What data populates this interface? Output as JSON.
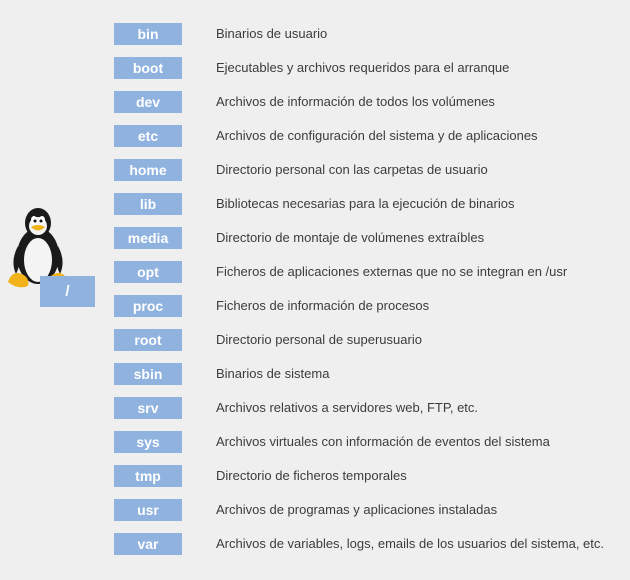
{
  "root": {
    "label": "/"
  },
  "directories": [
    {
      "name": "bin",
      "description": "Binarios de usuario"
    },
    {
      "name": "boot",
      "description": "Ejecutables y archivos requeridos para el arranque"
    },
    {
      "name": "dev",
      "description": "Archivos de información de todos los volúmenes"
    },
    {
      "name": "etc",
      "description": "Archivos de configuración del sistema y de aplicaciones"
    },
    {
      "name": "home",
      "description": "Directorio personal con las carpetas de usuario"
    },
    {
      "name": "lib",
      "description": "Bibliotecas necesarias para la ejecución de binarios"
    },
    {
      "name": "media",
      "description": "Directorio de montaje de volúmenes extraíbles"
    },
    {
      "name": "opt",
      "description": "Ficheros de aplicaciones externas que no se integran en /usr"
    },
    {
      "name": "proc",
      "description": "Ficheros de información de procesos"
    },
    {
      "name": "root",
      "description": "Directorio personal de superusuario"
    },
    {
      "name": "sbin",
      "description": "Binarios de sistema"
    },
    {
      "name": "srv",
      "description": "Archivos relativos a servidores web, FTP, etc."
    },
    {
      "name": "sys",
      "description": "Archivos virtuales con información de eventos del sistema"
    },
    {
      "name": "tmp",
      "description": "Directorio de ficheros temporales"
    },
    {
      "name": "usr",
      "description": "Archivos de programas y aplicaciones instaladas"
    },
    {
      "name": "var",
      "description": "Archivos de variables, logs, emails de los usuarios del sistema, etc."
    }
  ],
  "colors": {
    "box": "#8fb2df",
    "background": "#efefef",
    "text": "#3c3c3c"
  },
  "icons": {
    "mascot": "tux-penguin-icon"
  }
}
